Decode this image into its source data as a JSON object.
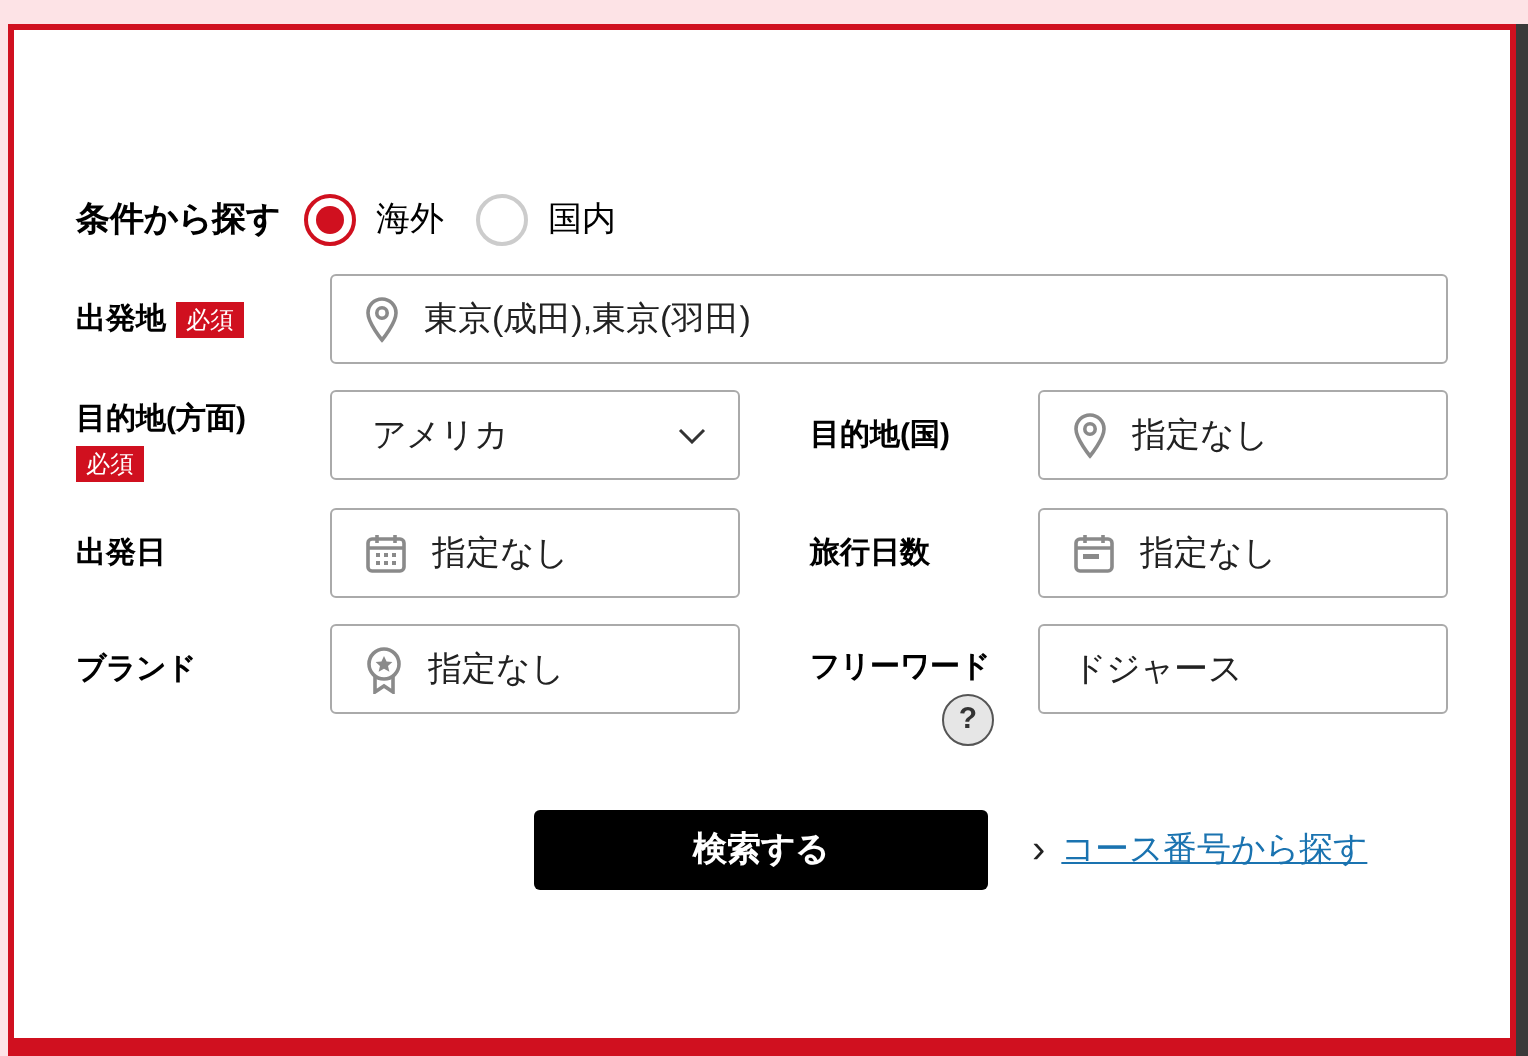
{
  "search_type": {
    "label": "条件から探す",
    "options": [
      {
        "label": "海外",
        "selected": true
      },
      {
        "label": "国内",
        "selected": false
      }
    ]
  },
  "fields": [
    {
      "label": "出発地",
      "badge": "必須",
      "kind": "location",
      "value": "東京(成田),東京(羽田)"
    },
    {
      "label": "目的地(方面)",
      "badge": "必須",
      "kind": "select",
      "value": "アメリカ"
    },
    {
      "label": "目的地(国)",
      "kind": "location",
      "value": "指定なし"
    },
    {
      "label": "出発日",
      "kind": "date",
      "value": "指定なし"
    },
    {
      "label": "旅行日数",
      "kind": "duration",
      "value": "指定なし"
    },
    {
      "label": "ブランド",
      "kind": "brand",
      "value": "指定なし"
    },
    {
      "label": "フリーワード",
      "help": "?",
      "kind": "text",
      "value": "ドジャース"
    }
  ],
  "search_button": "検索する",
  "course_link": {
    "arrow": "›",
    "label": "コース番号から探す"
  }
}
